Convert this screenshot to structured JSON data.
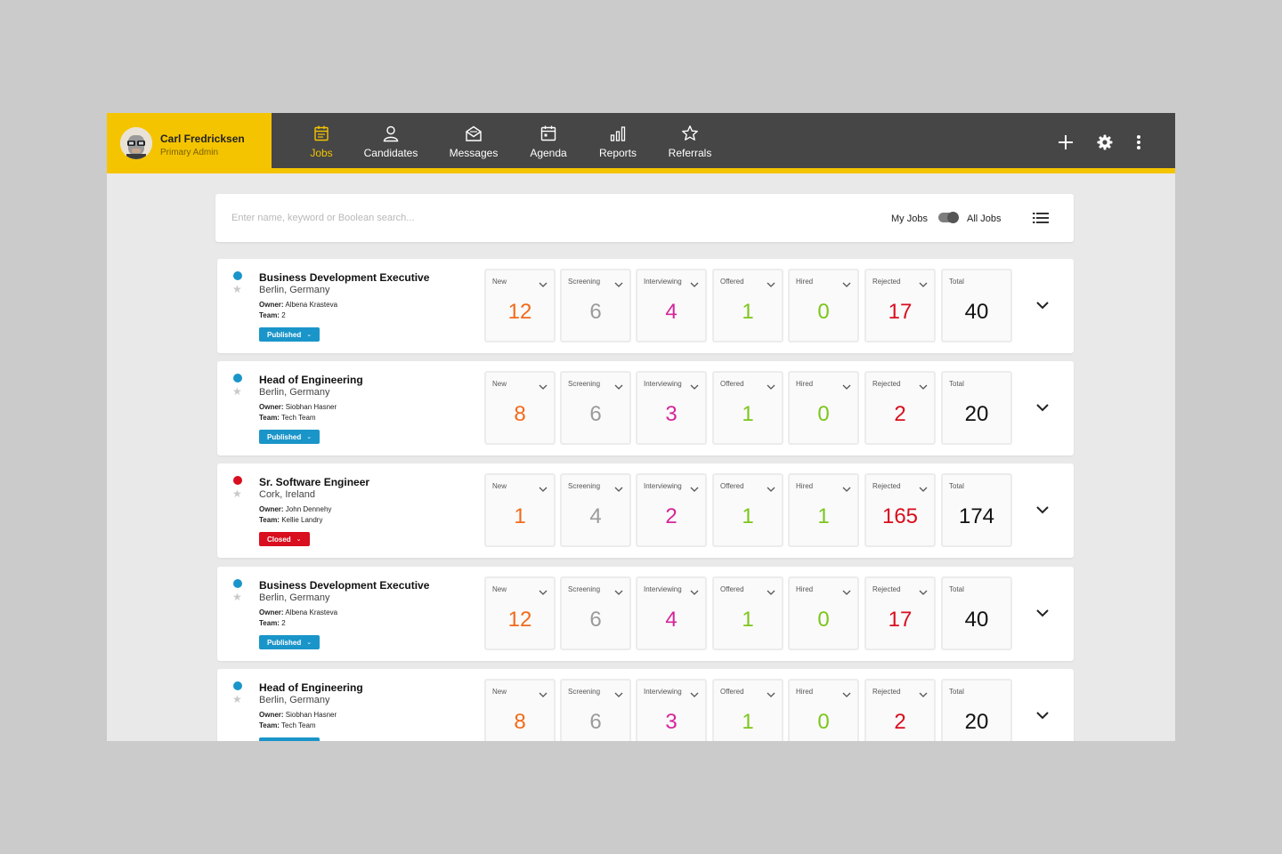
{
  "user": {
    "name": "Carl Fredricksen",
    "role": "Primary Admin"
  },
  "nav": [
    {
      "label": "Jobs",
      "icon": "jobs-icon",
      "active": true
    },
    {
      "label": "Candidates",
      "icon": "candidates-icon"
    },
    {
      "label": "Messages",
      "icon": "messages-icon"
    },
    {
      "label": "Agenda",
      "icon": "agenda-icon"
    },
    {
      "label": "Reports",
      "icon": "reports-icon"
    },
    {
      "label": "Referrals",
      "icon": "referrals-icon"
    }
  ],
  "header_actions": [
    "plus-icon",
    "gear-icon",
    "more-vertical-icon"
  ],
  "search": {
    "placeholder": "Enter name, keyword or Boolean search...",
    "value": ""
  },
  "filter": {
    "my_jobs_label": "My Jobs",
    "all_jobs_label": "All Jobs",
    "selected": "All Jobs"
  },
  "colors": {
    "brand": "#f5c400",
    "header": "#464646",
    "published": "#1a95c9",
    "closed": "#d90e1e",
    "new": "#f26a1b",
    "screening": "#9b9b9b",
    "interviewing": "#d6259a",
    "offered": "#7cc61b",
    "hired": "#7cc61b",
    "rejected": "#d90e1e",
    "total": "#111111"
  },
  "stage_labels": {
    "new": "New",
    "screening": "Screening",
    "interviewing": "Interviewing",
    "offered": "Offered",
    "hired": "Hired",
    "rejected": "Rejected",
    "total": "Total"
  },
  "jobs": [
    {
      "title": "Business Development Executive",
      "location": "Berlin, Germany",
      "owner_label": "Owner:",
      "owner": "Albena Krasteva",
      "team_label": "Team:",
      "team": "2",
      "status": "Published",
      "dot": "#1a95c9",
      "counts": {
        "new": "12",
        "screening": "6",
        "interviewing": "4",
        "offered": "1",
        "hired": "0",
        "rejected": "17",
        "total": "40"
      }
    },
    {
      "title": "Head of Engineering",
      "location": "Berlin, Germany",
      "owner_label": "Owner:",
      "owner": "Siobhan Hasner",
      "team_label": "Team:",
      "team": "Tech Team",
      "status": "Published",
      "dot": "#1a95c9",
      "counts": {
        "new": "8",
        "screening": "6",
        "interviewing": "3",
        "offered": "1",
        "hired": "0",
        "rejected": "2",
        "total": "20"
      }
    },
    {
      "title": "Sr. Software Engineer",
      "location": "Cork, Ireland",
      "owner_label": "Owner:",
      "owner": "John Dennehy",
      "team_label": "Team:",
      "team": "Kellie Landry",
      "status": "Closed",
      "dot": "#d90e1e",
      "counts": {
        "new": "1",
        "screening": "4",
        "interviewing": "2",
        "offered": "1",
        "hired": "1",
        "rejected": "165",
        "total": "174"
      }
    },
    {
      "title": "Business Development Executive",
      "location": "Berlin, Germany",
      "owner_label": "Owner:",
      "owner": "Albena Krasteva",
      "team_label": "Team:",
      "team": "2",
      "status": "Published",
      "dot": "#1a95c9",
      "counts": {
        "new": "12",
        "screening": "6",
        "interviewing": "4",
        "offered": "1",
        "hired": "0",
        "rejected": "17",
        "total": "40"
      }
    },
    {
      "title": "Head of Engineering",
      "location": "Berlin, Germany",
      "owner_label": "Owner:",
      "owner": "Siobhan Hasner",
      "team_label": "Team:",
      "team": "Tech Team",
      "status": "Published",
      "dot": "#1a95c9",
      "counts": {
        "new": "8",
        "screening": "6",
        "interviewing": "3",
        "offered": "1",
        "hired": "0",
        "rejected": "2",
        "total": "20"
      }
    }
  ]
}
